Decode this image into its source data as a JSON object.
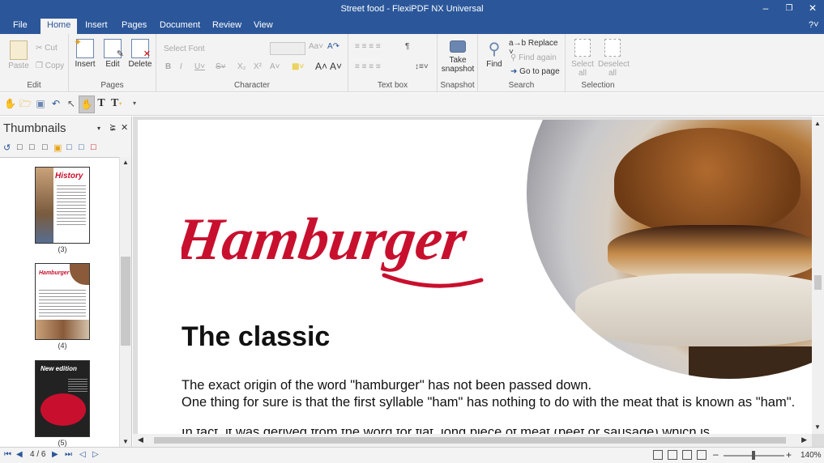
{
  "window": {
    "title": "Street food - FlexiPDF NX Universal"
  },
  "tabs": [
    "File",
    "Home",
    "Insert",
    "Pages",
    "Document",
    "Review",
    "View"
  ],
  "ribbon": {
    "edit": {
      "label": "Edit",
      "paste": "Paste",
      "cut": "Cut",
      "copy": "Copy"
    },
    "pages": {
      "label": "Pages",
      "insert": "Insert",
      "edit": "Edit",
      "delete": "Delete"
    },
    "character": {
      "label": "Character",
      "font_placeholder": "Select Font"
    },
    "textbox": {
      "label": "Text box"
    },
    "snapshot": {
      "label": "Snapshot",
      "take": "Take snapshot"
    },
    "search": {
      "label": "Search",
      "find": "Find",
      "replace": "Replace",
      "find_again": "Find again",
      "goto": "Go to page"
    },
    "selection": {
      "label": "Selection",
      "select_all": "Select all",
      "deselect_all": "Deselect all"
    }
  },
  "panel": {
    "title": "Thumbnails",
    "pages": [
      "(3)",
      "(4)",
      "(5)"
    ],
    "thumb_titles": [
      "History",
      "Hamburger",
      "New edition"
    ]
  },
  "document": {
    "title": "Hamburger",
    "heading": "The classic",
    "paragraph1": "The exact origin of the word \"hamburger\" has not been passed down.",
    "paragraph2": "One thing for sure is that the first syllable \"ham\" has nothing to do with the meat that is known as \"ham\".",
    "paragraph3": "In fact, it was derived from the德 the word for flat, long piece of meat (beef or sausage) which is..."
  },
  "status": {
    "page_indicator": "4 / 6",
    "zoom": "140%"
  },
  "colors": {
    "brand": "#2b579a",
    "hamburger_red": "#c8102e"
  }
}
